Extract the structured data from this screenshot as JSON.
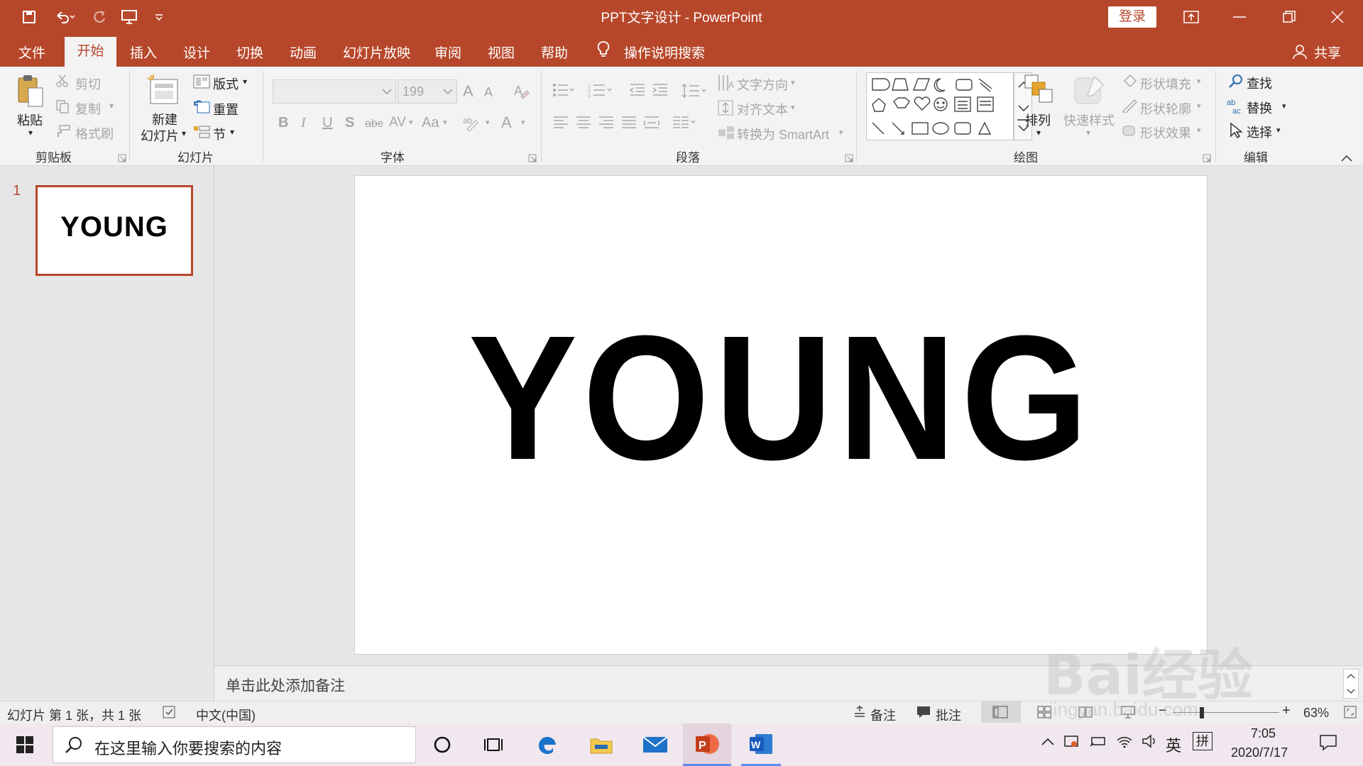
{
  "titlebar": {
    "title": "PPT文字设计  -  PowerPoint",
    "login_label": "登录",
    "background": "#b7472a"
  },
  "quick_access": [
    "save-icon",
    "undo-icon",
    "redo-icon",
    "present-icon",
    "customize-icon"
  ],
  "menu": {
    "tabs": [
      "文件",
      "开始",
      "插入",
      "设计",
      "切换",
      "动画",
      "幻灯片放映",
      "审阅",
      "视图",
      "帮助"
    ],
    "active": "开始",
    "search_label": "操作说明搜索",
    "share_label": "共享"
  },
  "ribbon": {
    "clipboard": {
      "paste": "粘贴",
      "cut": "剪切",
      "copy": "复制",
      "format_painter": "格式刷",
      "group": "剪贴板"
    },
    "slides": {
      "new_slide_line1": "新建",
      "new_slide_line2": "幻灯片",
      "layout": "版式",
      "reset": "重置",
      "section": "节",
      "group": "幻灯片"
    },
    "font": {
      "font_name": "",
      "font_size": "199",
      "group": "字体",
      "bold": "B",
      "italic": "I",
      "underline": "U",
      "shadow": "S",
      "strike": "abc",
      "spacing": "AV",
      "case": "Aa",
      "color": "A",
      "grow": "A",
      "shrink": "A"
    },
    "paragraph": {
      "text_direction": "文字方向",
      "align_text": "对齐文本",
      "smartart": "转换为 SmartArt",
      "group": "段落"
    },
    "drawing": {
      "arrange": "排列",
      "quick_styles": "快速样式",
      "shape_fill": "形状填充",
      "shape_outline": "形状轮廓",
      "shape_effects": "形状效果",
      "group": "绘图"
    },
    "editing": {
      "find": "查找",
      "replace": "替换",
      "select": "选择",
      "group": "编辑"
    }
  },
  "slides_pane": {
    "number": "1",
    "thumb_text": "YOUNG"
  },
  "slide": {
    "text": "YOUNG"
  },
  "notes": {
    "placeholder": "单击此处添加备注"
  },
  "statusbar": {
    "slide_info": "幻灯片 第 1 张，共 1 张",
    "language": "中文(中国)",
    "notes": "备注",
    "comments": "批注",
    "zoom": "63%"
  },
  "taskbar": {
    "search_placeholder": "在这里输入你要搜索的内容",
    "time": "7:05",
    "date": "2020/7/17",
    "ime": "英",
    "ime2": "拼"
  },
  "watermark": {
    "brand": "Bai经验",
    "url": "jingyan.baidu.com"
  }
}
